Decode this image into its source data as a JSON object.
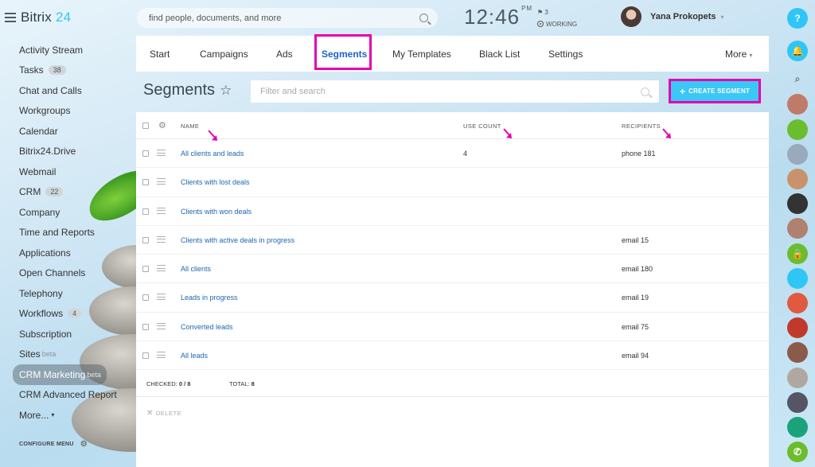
{
  "app": {
    "logo_text": "Bitrix",
    "logo_number": "24"
  },
  "sidebar": {
    "items": [
      {
        "label": "Activity Stream"
      },
      {
        "label": "Tasks",
        "counter": "38"
      },
      {
        "label": "Chat and Calls"
      },
      {
        "label": "Workgroups"
      },
      {
        "label": "Calendar"
      },
      {
        "label": "Bitrix24.Drive"
      },
      {
        "label": "Webmail"
      },
      {
        "label": "CRM",
        "counter": "22"
      },
      {
        "label": "Company"
      },
      {
        "label": "Time and Reports"
      },
      {
        "label": "Applications"
      },
      {
        "label": "Open Channels"
      },
      {
        "label": "Telephony"
      },
      {
        "label": "Workflows",
        "counter": "4"
      },
      {
        "label": "Subscription"
      },
      {
        "label": "Sites",
        "beta": "beta"
      },
      {
        "label": "CRM Marketing",
        "beta": "beta"
      },
      {
        "label": "CRM Advanced Report"
      },
      {
        "label": "More..."
      }
    ],
    "configure_label": "CONFIGURE MENU"
  },
  "topbar": {
    "search_placeholder": "find people, documents, and more",
    "clock": "12:46",
    "ampm": "PM",
    "flag_count": "3",
    "work_status": "WORKING",
    "user_name": "Yana Prokopets"
  },
  "tabs": [
    "Start",
    "Campaigns",
    "Ads",
    "Segments",
    "My Templates",
    "Black List",
    "Settings",
    "More"
  ],
  "page": {
    "title": "Segments",
    "filter_placeholder": "Filter and search",
    "create_button": "CREATE SEGMENT"
  },
  "grid": {
    "columns": [
      "NAME",
      "USE COUNT",
      "RECIPIENTS"
    ],
    "rows": [
      {
        "name": "All clients and leads",
        "use_count": "4",
        "recipients": "phone 181"
      },
      {
        "name": "Clients with lost deals",
        "use_count": "",
        "recipients": ""
      },
      {
        "name": "Clients with won deals",
        "use_count": "",
        "recipients": ""
      },
      {
        "name": "Clients with active deals in progress",
        "use_count": "",
        "recipients": "email 15"
      },
      {
        "name": "All clients",
        "use_count": "",
        "recipients": "email 180"
      },
      {
        "name": "Leads in progress",
        "use_count": "",
        "recipients": "email 19"
      },
      {
        "name": "Converted leads",
        "use_count": "",
        "recipients": "email 75"
      },
      {
        "name": "All leads",
        "use_count": "",
        "recipients": "email 94"
      }
    ],
    "footer": {
      "checked_label": "CHECKED:",
      "checked_value": "0 / 8",
      "total_label": "TOTAL:",
      "total_value": "8"
    },
    "delete_label": "DELETE"
  },
  "colors": {
    "accent": "#3bc8f5",
    "highlight": "#e400b0",
    "link": "#2067b0"
  }
}
